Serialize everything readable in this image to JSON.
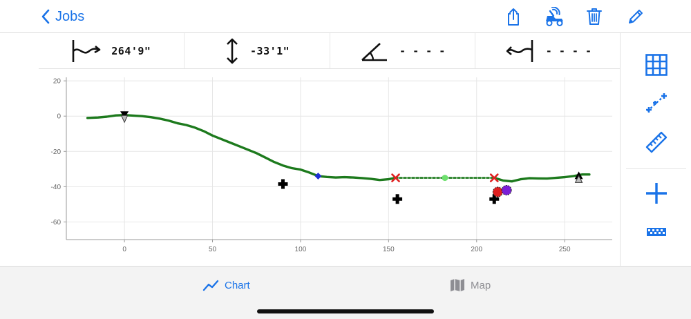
{
  "nav": {
    "back_label": "Jobs"
  },
  "metrics": [
    {
      "icon": "horizontal-distance-icon",
      "value": "264'9\""
    },
    {
      "icon": "vertical-distance-icon",
      "value": "-33'1\""
    },
    {
      "icon": "angle-icon",
      "value": "- - - -"
    },
    {
      "icon": "bore-length-icon",
      "value": "- - - -"
    }
  ],
  "tabs": [
    {
      "label": "Chart",
      "icon": "line-chart-icon",
      "active": true
    },
    {
      "label": "Map",
      "icon": "map-icon",
      "active": false
    }
  ],
  "colors": {
    "accent": "#1a73e8",
    "profile_line": "#1d7a1d",
    "marker_red": "#e02020",
    "marker_blue": "#1f2fd6",
    "marker_purple": "#7a1fd6",
    "tab_inactive": "#8e8e93"
  },
  "chart_data": {
    "type": "line",
    "xlim": [
      -33,
      277
    ],
    "ylim": [
      -70,
      22
    ],
    "xticks": [
      0,
      50,
      100,
      150,
      200,
      250
    ],
    "yticks": [
      20,
      0,
      -20,
      -40,
      -60
    ],
    "grid": true,
    "series": [
      {
        "values_xy": [
          [
            -21,
            -1
          ],
          [
            -15,
            -0.8
          ],
          [
            -10,
            -0.3
          ],
          [
            -5,
            0.4
          ],
          [
            0,
            0.6
          ],
          [
            5,
            0.3
          ],
          [
            10,
            0
          ],
          [
            15,
            -0.6
          ],
          [
            20,
            -1.4
          ],
          [
            25,
            -2.5
          ],
          [
            30,
            -4
          ],
          [
            35,
            -5
          ],
          [
            40,
            -6.5
          ],
          [
            45,
            -8.5
          ],
          [
            50,
            -11
          ],
          [
            55,
            -13
          ],
          [
            60,
            -15
          ],
          [
            65,
            -17
          ],
          [
            70,
            -19
          ],
          [
            75,
            -21
          ],
          [
            80,
            -23.5
          ],
          [
            85,
            -26
          ],
          [
            90,
            -28
          ],
          [
            95,
            -29.5
          ],
          [
            100,
            -30.3
          ],
          [
            105,
            -32
          ],
          [
            110,
            -34
          ],
          [
            115,
            -34.5
          ],
          [
            120,
            -34.8
          ],
          [
            125,
            -34.6
          ],
          [
            130,
            -34.8
          ],
          [
            135,
            -35.1
          ],
          [
            140,
            -35.6
          ],
          [
            145,
            -36.2
          ],
          [
            150,
            -35.8
          ],
          [
            154,
            -35
          ]
        ]
      },
      {
        "style": "dotted",
        "values_xy": [
          [
            154,
            -35
          ],
          [
            210,
            -35
          ]
        ]
      },
      {
        "values_xy": [
          [
            210,
            -35
          ],
          [
            215,
            -36.5
          ],
          [
            220,
            -37
          ],
          [
            225,
            -35.8
          ],
          [
            230,
            -35.2
          ],
          [
            235,
            -35.3
          ],
          [
            240,
            -35.4
          ],
          [
            245,
            -35
          ],
          [
            250,
            -34.6
          ],
          [
            255,
            -34
          ],
          [
            260,
            -33.1
          ],
          [
            264,
            -33.1
          ]
        ]
      }
    ],
    "markers": [
      {
        "shape": "triangle-down",
        "x": 0,
        "y": 0,
        "color": "#000000"
      },
      {
        "shape": "triangle-up",
        "x": 258,
        "y": -34.5,
        "color": "#000000"
      },
      {
        "shape": "diamond",
        "x": 110,
        "y": -34,
        "color": "#1f2fd6"
      },
      {
        "shape": "x",
        "x": 154,
        "y": -35,
        "color": "#e02020"
      },
      {
        "shape": "x",
        "x": 210,
        "y": -35,
        "color": "#e02020"
      },
      {
        "shape": "dot",
        "x": 182,
        "y": -35,
        "color": "#6ee06e"
      },
      {
        "shape": "cross",
        "x": 90,
        "y": -38.5,
        "color": "#000000"
      },
      {
        "shape": "cross",
        "x": 155,
        "y": -47,
        "color": "#000000"
      },
      {
        "shape": "cross",
        "x": 210,
        "y": -47,
        "color": "#000000"
      },
      {
        "shape": "circle",
        "x": 212,
        "y": -43,
        "color": "#e02020"
      },
      {
        "shape": "circle",
        "x": 217,
        "y": -42,
        "color": "#7a1fd6"
      }
    ]
  }
}
